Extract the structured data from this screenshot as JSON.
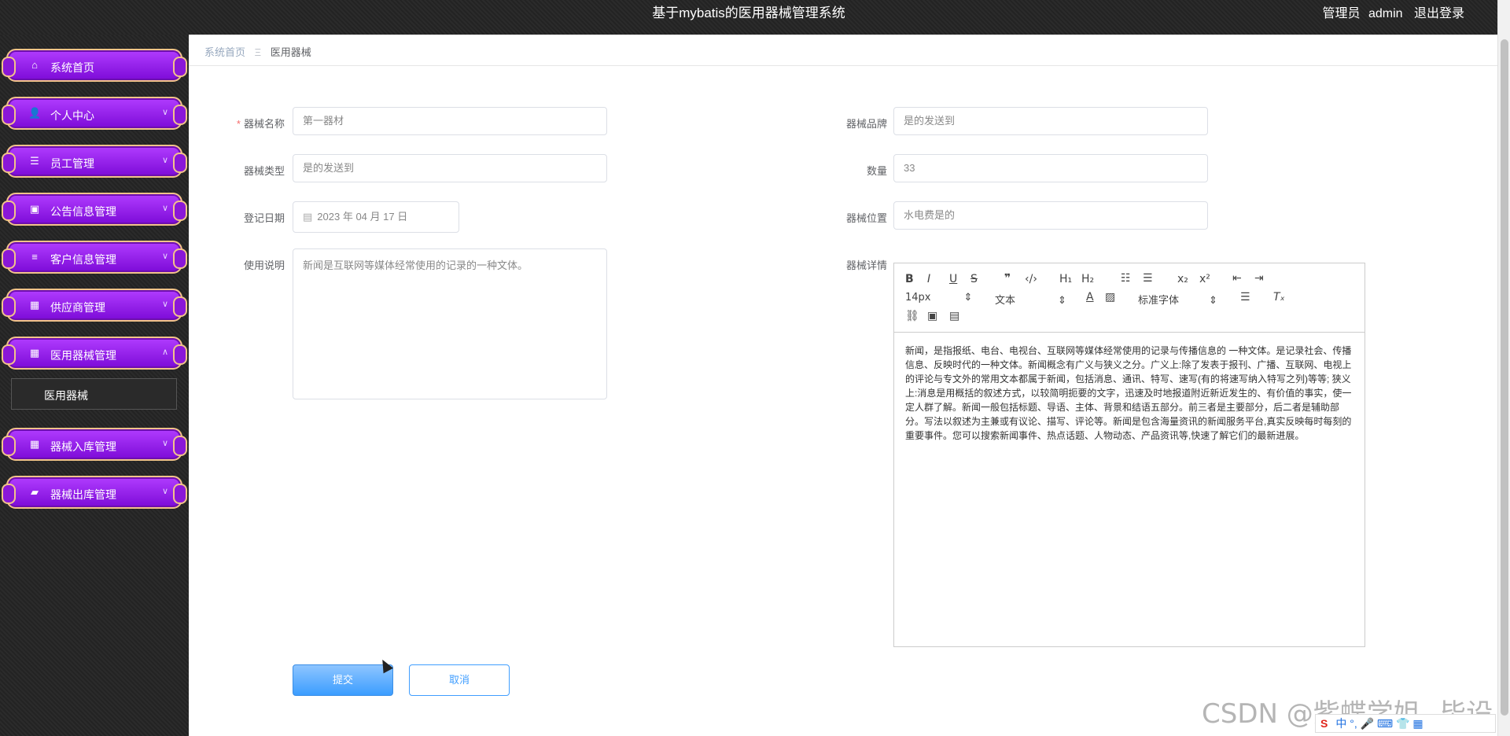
{
  "header": {
    "title": "基于mybatis的医用器械管理系统",
    "role": "管理员",
    "username": "admin",
    "logout": "退出登录"
  },
  "sidebar": {
    "items": [
      {
        "label": "系统首页",
        "icon": "home-icon"
      },
      {
        "label": "个人中心",
        "icon": "user-icon"
      },
      {
        "label": "员工管理",
        "icon": "sliders-icon"
      },
      {
        "label": "公告信息管理",
        "icon": "chart-icon"
      },
      {
        "label": "客户信息管理",
        "icon": "list-icon"
      },
      {
        "label": "供应商管理",
        "icon": "grid-icon"
      },
      {
        "label": "医用器械管理",
        "icon": "grid-icon"
      },
      {
        "label": "器械入库管理",
        "icon": "grid-icon"
      },
      {
        "label": "器械出库管理",
        "icon": "wallet-icon"
      }
    ],
    "submenu_label": "医用器械"
  },
  "breadcrumb": {
    "home": "系统首页",
    "separator": "Ξ",
    "current": "医用器械"
  },
  "form": {
    "name_label": "器械名称",
    "name_value": "第一器材",
    "type_label": "器械类型",
    "type_value": "是的发送到",
    "date_label": "登记日期",
    "date_value": "2023 年 04 月 17 日",
    "usage_label": "使用说明",
    "usage_value": "新闻是互联网等媒体经常使用的记录的一种文体。",
    "brand_label": "器械品牌",
    "brand_value": "是的发送到",
    "qty_label": "数量",
    "qty_value": "33",
    "location_label": "器械位置",
    "location_value": "水电费是的",
    "detail_label": "器械详情"
  },
  "editor": {
    "font_size": "14px",
    "block_format": "文本",
    "font_family": "标准字体",
    "content": "新闻，是指报纸、电台、电视台、互联网等媒体经常使用的记录与传播信息的 一种文体。是记录社会、传播信息、反映时代的一种文体。新闻概念有广义与狭义之分。广义上:除了发表于报刊、广播、互联网、电视上的评论与专文外的常用文本都属于新闻，包括消息、通讯、特写、速写(有的将速写纳入特写之列)等等; 狭义上:消息是用概括的叙述方式，以较简明扼要的文字，迅速及时地报道附近新近发生的、有价值的事实，使一定人群了解。新闻一般包括标题、导语、主体、背景和结语五部分。前三者是主要部分，后二者是辅助部分。写法以叙述为主兼或有议论、描写、评论等。新闻是包含海量资讯的新闻服务平台,真实反映每时每刻的重要事件。您可以搜索新闻事件、热点话题、人物动态、产品资讯等,快速了解它们的最新进展。"
  },
  "buttons": {
    "submit": "提交",
    "cancel": "取消"
  },
  "watermark": "CSDN @紫蝶学姐--毕设",
  "ime": "中 °, 🎤 ⌨ 👕 ▦"
}
